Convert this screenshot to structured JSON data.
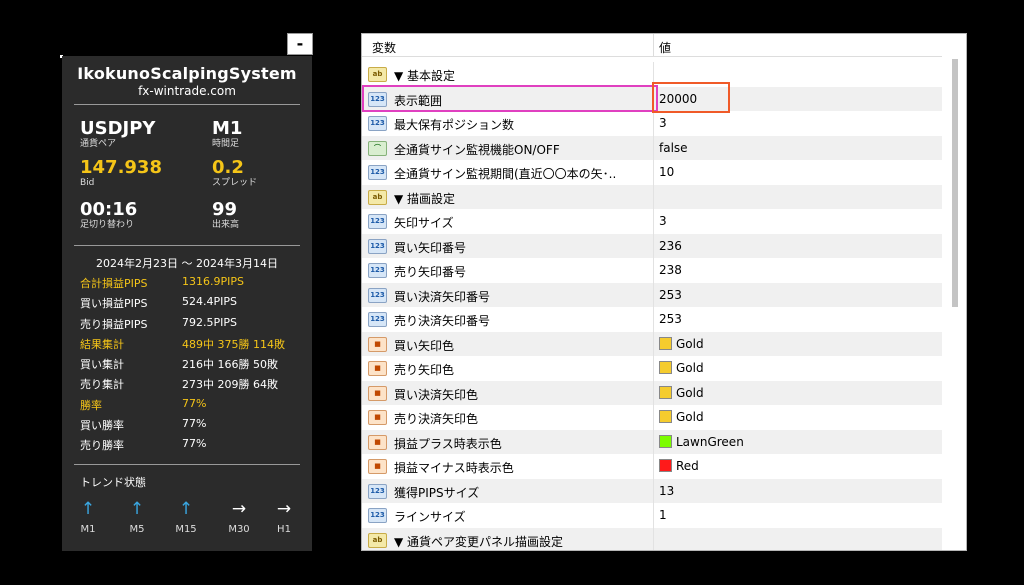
{
  "panel": {
    "title": "IkokunoScalpingSystem",
    "site": "fx-wintrade.com",
    "minimize_label": "-",
    "symbol": {
      "value": "USDJPY",
      "label": "通貨ペア"
    },
    "timeframe": {
      "value": "M1",
      "label": "時間足"
    },
    "bid": {
      "value": "147.938",
      "label": "Bid"
    },
    "spread": {
      "value": "0.2",
      "label": "スプレッド"
    },
    "bar_timer": {
      "value": "00:16",
      "label": "足切り替わり"
    },
    "volume": {
      "value": "99",
      "label": "出来高"
    },
    "period": "2024年2月23日 ～ 2024年3月14日",
    "stats": [
      {
        "key": "合計損益PIPS",
        "value": "1316.9PIPS"
      },
      {
        "key": "買い損益PIPS",
        "value": "524.4PIPS"
      },
      {
        "key": "売り損益PIPS",
        "value": "792.5PIPS"
      },
      {
        "key": "結果集計",
        "value": "489中 375勝 114敗"
      },
      {
        "key": "買い集計",
        "value": "216中 166勝 50敗"
      },
      {
        "key": "売り集計",
        "value": "273中 209勝 64敗"
      },
      {
        "key": "勝率",
        "value": "77%"
      },
      {
        "key": "買い勝率",
        "value": "77%"
      },
      {
        "key": "売り勝率",
        "value": "77%"
      }
    ],
    "trend_title": "トレンド状態",
    "trend": [
      {
        "tf": "M1",
        "arrow": "↑",
        "dir": "up"
      },
      {
        "tf": "M5",
        "arrow": "↑",
        "dir": "up"
      },
      {
        "tf": "M15",
        "arrow": "↑",
        "dir": "up"
      },
      {
        "tf": "M30",
        "arrow": "→",
        "dir": "flat"
      },
      {
        "tf": "H1",
        "arrow": "→",
        "dir": "flat"
      }
    ],
    "colors": {
      "gold": "#f5c518",
      "arrow_up": "#3aa6e0",
      "bg": "#2b2b2b"
    }
  },
  "grid": {
    "col_variable": "変数",
    "col_value": "値",
    "rows": [
      {
        "icon": "ab",
        "icon_text": "ab",
        "name": "▼ 基本設定",
        "value": ""
      },
      {
        "icon": "num",
        "icon_text": "123",
        "name": "表示範囲",
        "value": "20000"
      },
      {
        "icon": "num",
        "icon_text": "123",
        "name": "最大保有ポジション数",
        "value": "3"
      },
      {
        "icon": "bool",
        "icon_text": "⌒",
        "name": "全通貨サイン監視機能ON/OFF",
        "value": "false"
      },
      {
        "icon": "num",
        "icon_text": "123",
        "name": "全通貨サイン監視期間(直近〇〇本の矢･..",
        "value": "10"
      },
      {
        "icon": "ab",
        "icon_text": "ab",
        "name": "▼ 描画設定",
        "value": ""
      },
      {
        "icon": "num",
        "icon_text": "123",
        "name": "矢印サイズ",
        "value": "3"
      },
      {
        "icon": "num",
        "icon_text": "123",
        "name": "買い矢印番号",
        "value": "236"
      },
      {
        "icon": "num",
        "icon_text": "123",
        "name": "売り矢印番号",
        "value": "238"
      },
      {
        "icon": "num",
        "icon_text": "123",
        "name": "買い決済矢印番号",
        "value": "253"
      },
      {
        "icon": "num",
        "icon_text": "123",
        "name": "売り決済矢印番号",
        "value": "253"
      },
      {
        "icon": "col",
        "icon_text": "■",
        "name": "買い矢印色",
        "value": "Gold",
        "swatch": "#f5cc2e"
      },
      {
        "icon": "col",
        "icon_text": "■",
        "name": "売り矢印色",
        "value": "Gold",
        "swatch": "#f5cc2e"
      },
      {
        "icon": "col",
        "icon_text": "■",
        "name": "買い決済矢印色",
        "value": "Gold",
        "swatch": "#f5cc2e"
      },
      {
        "icon": "col",
        "icon_text": "■",
        "name": "売り決済矢印色",
        "value": "Gold",
        "swatch": "#f5cc2e"
      },
      {
        "icon": "col",
        "icon_text": "■",
        "name": "損益プラス時表示色",
        "value": "LawnGreen",
        "swatch": "#7cfc00"
      },
      {
        "icon": "col",
        "icon_text": "■",
        "name": "損益マイナス時表示色",
        "value": "Red",
        "swatch": "#ff1a1a"
      },
      {
        "icon": "num",
        "icon_text": "123",
        "name": "獲得PIPSサイズ",
        "value": "13"
      },
      {
        "icon": "num",
        "icon_text": "123",
        "name": "ラインサイズ",
        "value": "1"
      },
      {
        "icon": "ab",
        "icon_text": "ab",
        "name": "▼ 通貨ペア変更パネル描画設定",
        "value": ""
      }
    ],
    "highlight_colors": {
      "name": "#e040c0",
      "value": "#f05a28"
    }
  }
}
